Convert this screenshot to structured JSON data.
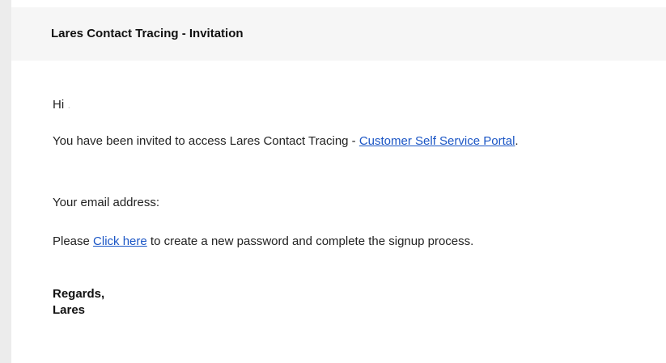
{
  "email": {
    "subject": "Lares Contact Tracing - Invitation",
    "greeting": "Hi",
    "greeting_punct": ".",
    "invite_text": "You have been invited to access Lares Contact Tracing - ",
    "portal_link": "Customer Self Service Portal",
    "invite_end": ".",
    "email_label": "Your email address:",
    "password_prefix": "Please ",
    "click_here_link": "Click here",
    "password_suffix": " to create a new password and complete the signup process.",
    "regards": "Regards,",
    "signature": "Lares"
  },
  "colors": {
    "link": "#1a55c5",
    "header_background": "#f6f6f6",
    "side_bar": "#ececec"
  }
}
